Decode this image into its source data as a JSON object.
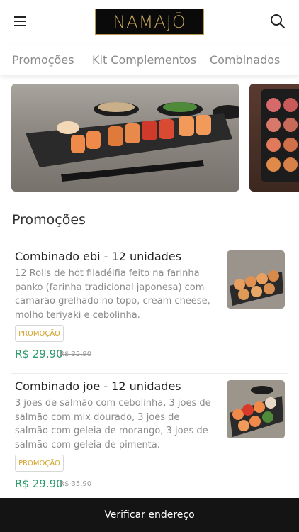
{
  "header": {
    "logo_text": "NAMAJŌ",
    "menu_icon": "hamburger-icon",
    "search_icon": "search-icon"
  },
  "tabs": [
    {
      "label": "Promoções"
    },
    {
      "label": "Kit Complementos"
    },
    {
      "label": "Combinados"
    }
  ],
  "section": {
    "title": "Promoções"
  },
  "products": [
    {
      "title": "Combinado ebi - 12 unidades",
      "description": "12 Rolls de hot filadélfia feito na farinha panko (farinha tradicional japonesa) com camarão grelhado no topo, cream cheese, molho teriyaki e cebolinha.",
      "badge": "PROMOÇÃO",
      "price": "R$ 29.90",
      "old_price": "R$ 35.90"
    },
    {
      "title": "Combinado joe - 12 unidades",
      "description": "3 joes de salmão com cebolinha, 3 joes de salmão com mix dourado, 3 joes de salmão com geleia de morango, 3 joes de salmão com geleia de pimenta.",
      "badge": "PROMOÇÃO",
      "price": "R$ 29.90",
      "old_price": "R$ 35.90"
    }
  ],
  "bottom_bar": {
    "label": "Verificar endereço"
  },
  "colors": {
    "price": "#2e9a6b",
    "badge": "#d3a12a",
    "logo_gold": "#c9a75a",
    "bottom_bar": "#141414"
  }
}
